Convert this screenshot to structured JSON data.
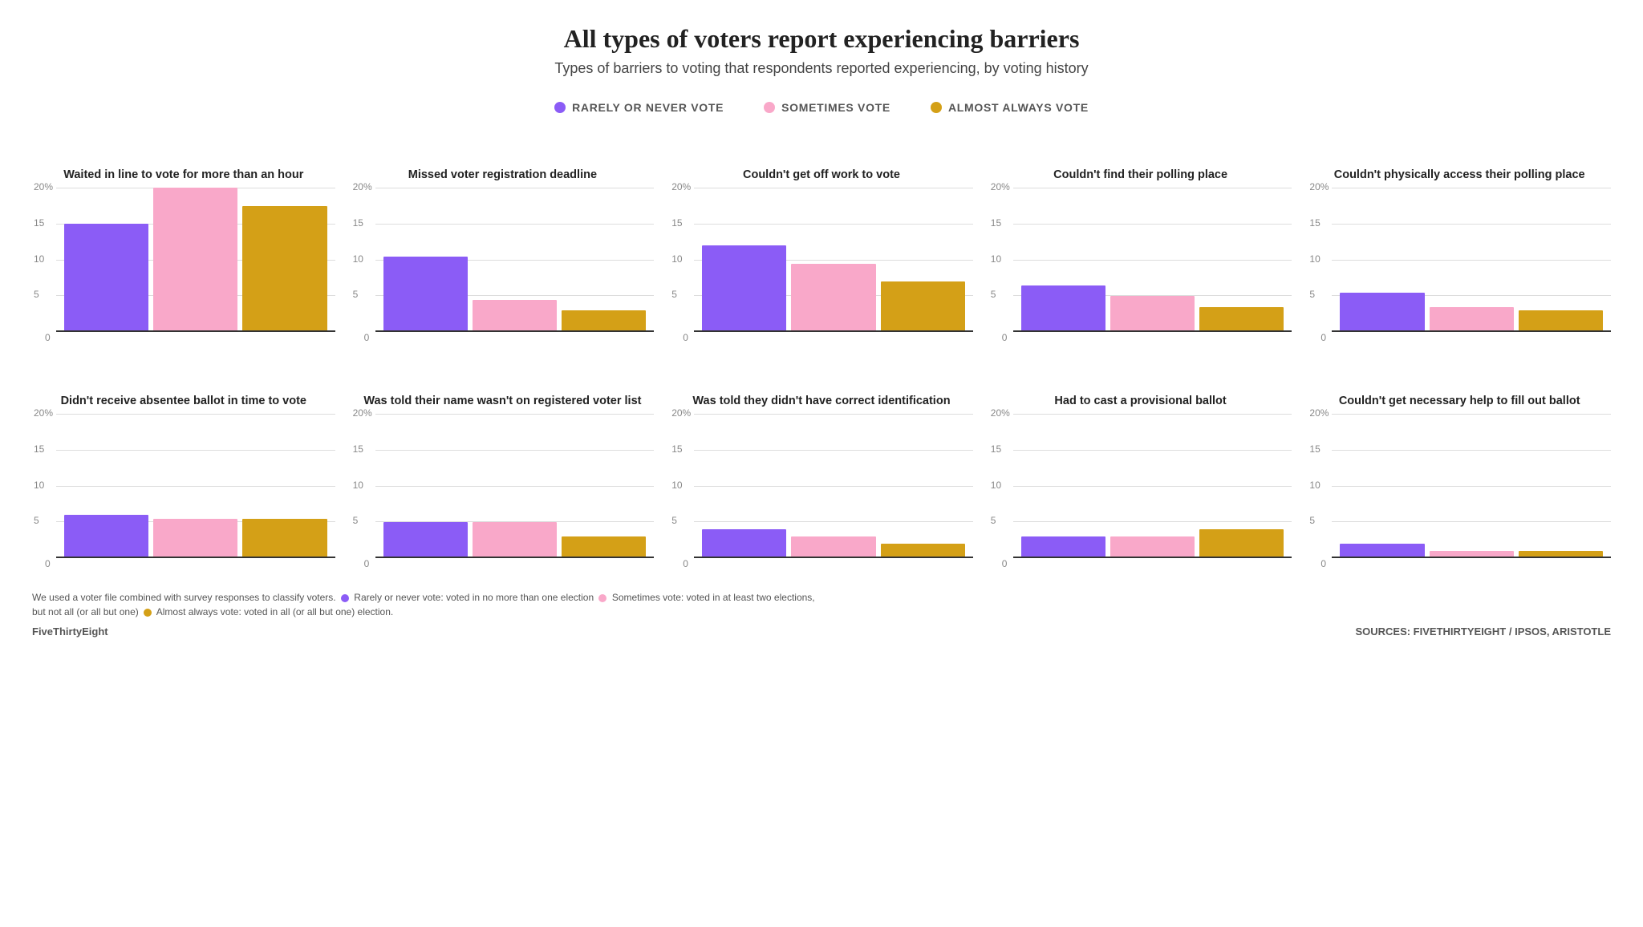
{
  "title": "All types of voters report experiencing barriers",
  "subtitle": "Types of barriers to voting that respondents reported experiencing, by voting history",
  "legend": {
    "items": [
      {
        "label": "RARELY OR NEVER VOTE",
        "color": "#8B5CF6"
      },
      {
        "label": "SOMETIMES VOTE",
        "color": "#F9A8C9"
      },
      {
        "label": "ALMOST ALWAYS VOTE",
        "color": "#D4A017"
      }
    ]
  },
  "row1": [
    {
      "label": "Waited in line to vote for more than an hour",
      "bars": [
        15,
        20,
        17.5
      ],
      "ymax": 20
    },
    {
      "label": "Missed voter registration deadline",
      "bars": [
        10.5,
        4.5,
        3
      ],
      "ymax": 20
    },
    {
      "label": "Couldn't get off work to vote",
      "bars": [
        12,
        9.5,
        7
      ],
      "ymax": 20
    },
    {
      "label": "Couldn't find their polling place",
      "bars": [
        6.5,
        5,
        3.5
      ],
      "ymax": 20
    },
    {
      "label": "Couldn't physically access their polling place",
      "bars": [
        5.5,
        3.5,
        3
      ],
      "ymax": 20
    }
  ],
  "row2": [
    {
      "label": "Didn't receive absentee ballot in time to vote",
      "bars": [
        6,
        5.5,
        5.5
      ],
      "ymax": 20
    },
    {
      "label": "Was told their name wasn't on registered voter list",
      "bars": [
        5,
        5,
        3
      ],
      "ymax": 20
    },
    {
      "label": "Was told they didn't have correct identification",
      "bars": [
        4,
        3,
        2
      ],
      "ymax": 20
    },
    {
      "label": "Had to cast a provisional ballot",
      "bars": [
        3,
        3,
        4
      ],
      "ymax": 20
    },
    {
      "label": "Couldn't get necessary help to fill out ballot",
      "bars": [
        2,
        1,
        1
      ],
      "ymax": 20
    }
  ],
  "y_ticks": [
    0,
    5,
    10,
    15,
    20
  ],
  "bar_colors": [
    "#8B5CF6",
    "#F9A8C9",
    "#D4A017"
  ],
  "footer_note": "We used a voter file combined with survey responses to classify voters.",
  "footer_rarely": "Rarely or never vote: voted in no more than one election",
  "footer_sometimes": "Sometimes vote: voted in at least two elections, but not all (or all but one)",
  "footer_always": "Almost always vote: voted in all (or all but one) election.",
  "branding": "FiveThirtyEight",
  "sources": "SOURCES: FIVETHIRTYEIGHT / IPSOS, ARISTOTLE"
}
